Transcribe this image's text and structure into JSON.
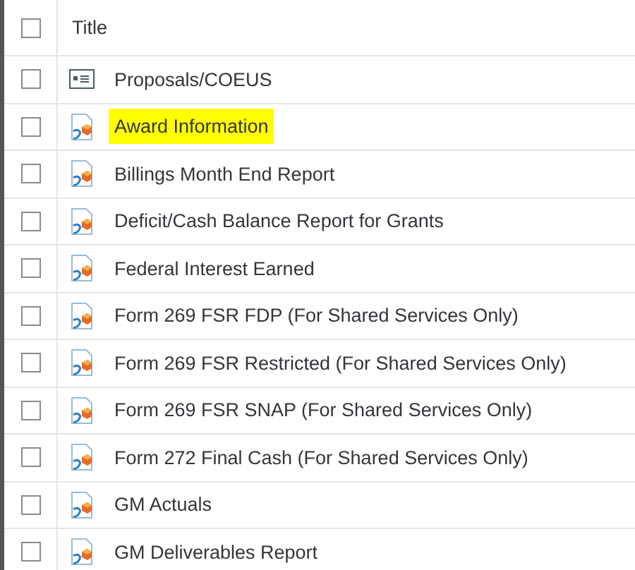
{
  "table": {
    "header": {
      "checked": false,
      "title": "Title"
    },
    "rows": [
      {
        "kind": "document",
        "title": "Proposals/COEUS",
        "checked": false,
        "highlighted": false
      },
      {
        "kind": "report",
        "title": "Award Information",
        "checked": false,
        "highlighted": true
      },
      {
        "kind": "report",
        "title": "Billings Month End Report",
        "checked": false,
        "highlighted": false
      },
      {
        "kind": "report",
        "title": "Deficit/Cash Balance Report for Grants",
        "checked": false,
        "highlighted": false
      },
      {
        "kind": "report",
        "title": "Federal Interest Earned",
        "checked": false,
        "highlighted": false
      },
      {
        "kind": "report",
        "title": "Form 269 FSR FDP (For Shared Services Only)",
        "checked": false,
        "highlighted": false
      },
      {
        "kind": "report",
        "title": "Form 269 FSR Restricted (For Shared Services Only)",
        "checked": false,
        "highlighted": false
      },
      {
        "kind": "report",
        "title": "Form 269 FSR SNAP (For Shared Services Only)",
        "checked": false,
        "highlighted": false
      },
      {
        "kind": "report",
        "title": "Form 272 Final Cash (For Shared Services Only)",
        "checked": false,
        "highlighted": false
      },
      {
        "kind": "report",
        "title": "GM Actuals",
        "checked": false,
        "highlighted": false
      },
      {
        "kind": "report",
        "title": "GM Deliverables Report",
        "checked": false,
        "highlighted": false
      }
    ]
  }
}
